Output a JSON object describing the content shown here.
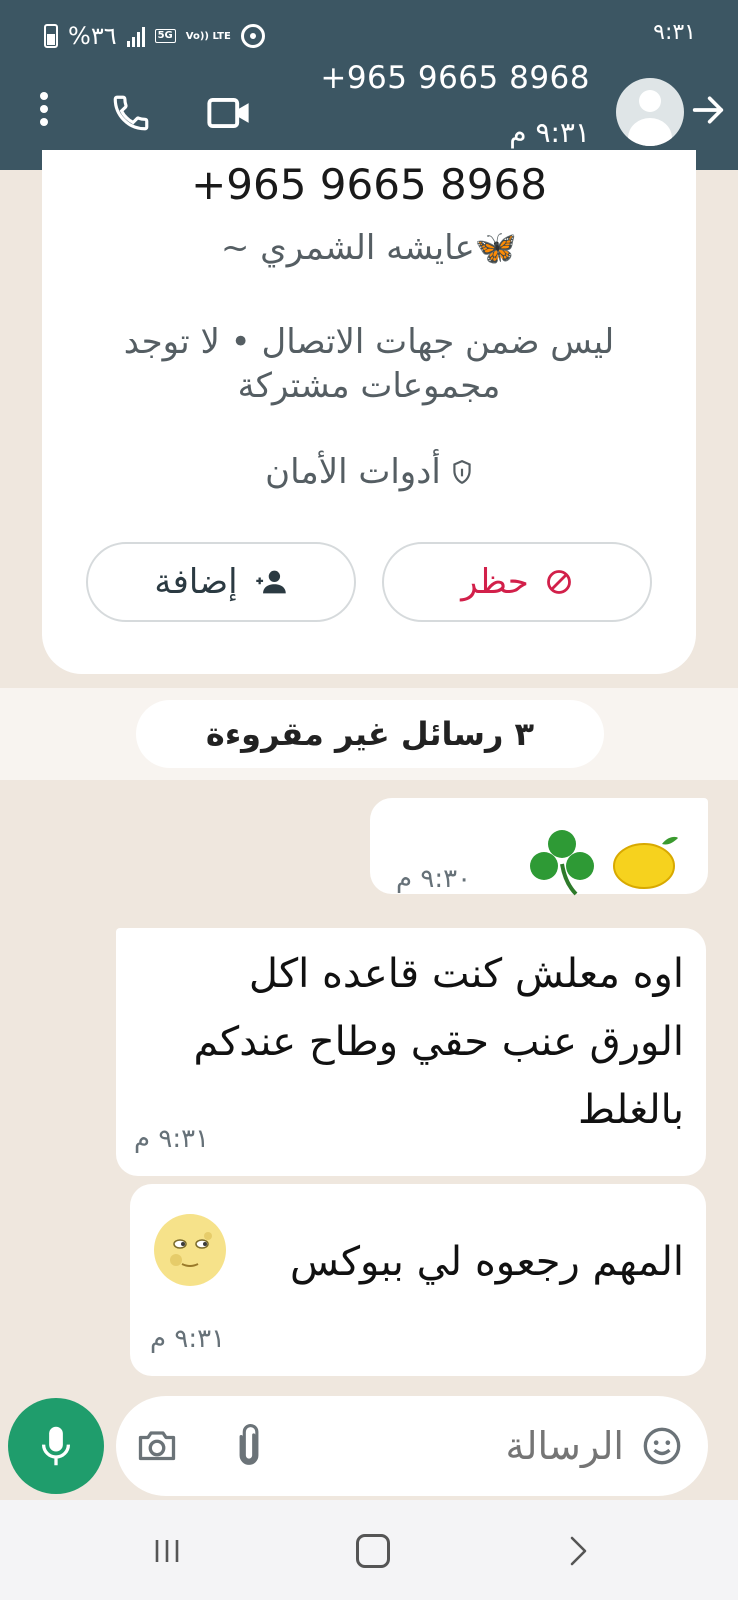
{
  "status_bar": {
    "time": "٩:٣١",
    "battery": "%٣٦",
    "network": "5G",
    "volte": "Vo)) LTE"
  },
  "header": {
    "title": "+965 9665 8968",
    "subtitle": "٩:٣١ م"
  },
  "contact_card": {
    "phone": "+965 9665 8968",
    "name": "~ عايشه الشمري🦋",
    "info": "ليس ضمن جهات الاتصال • لا توجد مجموعات مشتركة",
    "safety_tools": "أدوات الأمان",
    "block_label": "حظر",
    "add_label": "إضافة"
  },
  "unread_banner": "٣ رسائل غير مقروءة",
  "messages": [
    {
      "direction": "outgoing",
      "emojis": "🍋☘️",
      "time": "٩:٣٠ م"
    },
    {
      "direction": "incoming",
      "text": "اوه معلش كنت قاعده اكل الورق عنب حقي وطاح عندكم بالغلط",
      "time": "٩:٣١ م"
    },
    {
      "direction": "incoming",
      "text": "المهم رجعوه لي ببوكس",
      "emoji": "🌝",
      "time": "٩:٣١ م"
    }
  ],
  "composer": {
    "placeholder": "الرسالة"
  },
  "colors": {
    "header_bg": "#3c5663",
    "chat_bg": "#efe7de",
    "mic_green": "#1f9d6c",
    "block_red": "#d2204a"
  },
  "icons": [
    "more-icon",
    "call-icon",
    "video-call-icon",
    "back-arrow-icon",
    "shield-icon",
    "block-icon",
    "add-contact-icon",
    "mic-icon",
    "emoji-icon",
    "attach-icon",
    "camera-icon"
  ]
}
